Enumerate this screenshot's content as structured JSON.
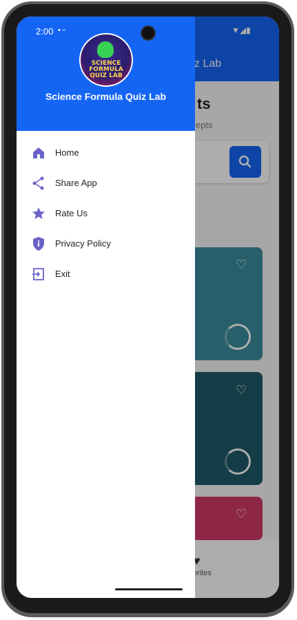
{
  "status_bar": {
    "time": "2:00"
  },
  "background": {
    "appbar_title": "z Lab",
    "heading": "ts",
    "subheading": "epts",
    "favorites_label": "orites",
    "cards": [
      {
        "color": "#3a8d9e"
      },
      {
        "color": "#1f5b6b"
      },
      {
        "color": "#d13a68"
      }
    ]
  },
  "drawer": {
    "app_title": "Science Formula Quiz Lab",
    "logo_text": "SCIENCE FORMULA QUIZ LAB",
    "items": [
      {
        "label": "Home",
        "icon": "home-icon"
      },
      {
        "label": "Share App",
        "icon": "share-icon"
      },
      {
        "label": "Rate Us",
        "icon": "star-icon"
      },
      {
        "label": "Privacy Policy",
        "icon": "shield-icon"
      },
      {
        "label": "Exit",
        "icon": "exit-icon"
      }
    ]
  },
  "colors": {
    "primary": "#1565f5",
    "icon_accent": "#6b63c9"
  }
}
